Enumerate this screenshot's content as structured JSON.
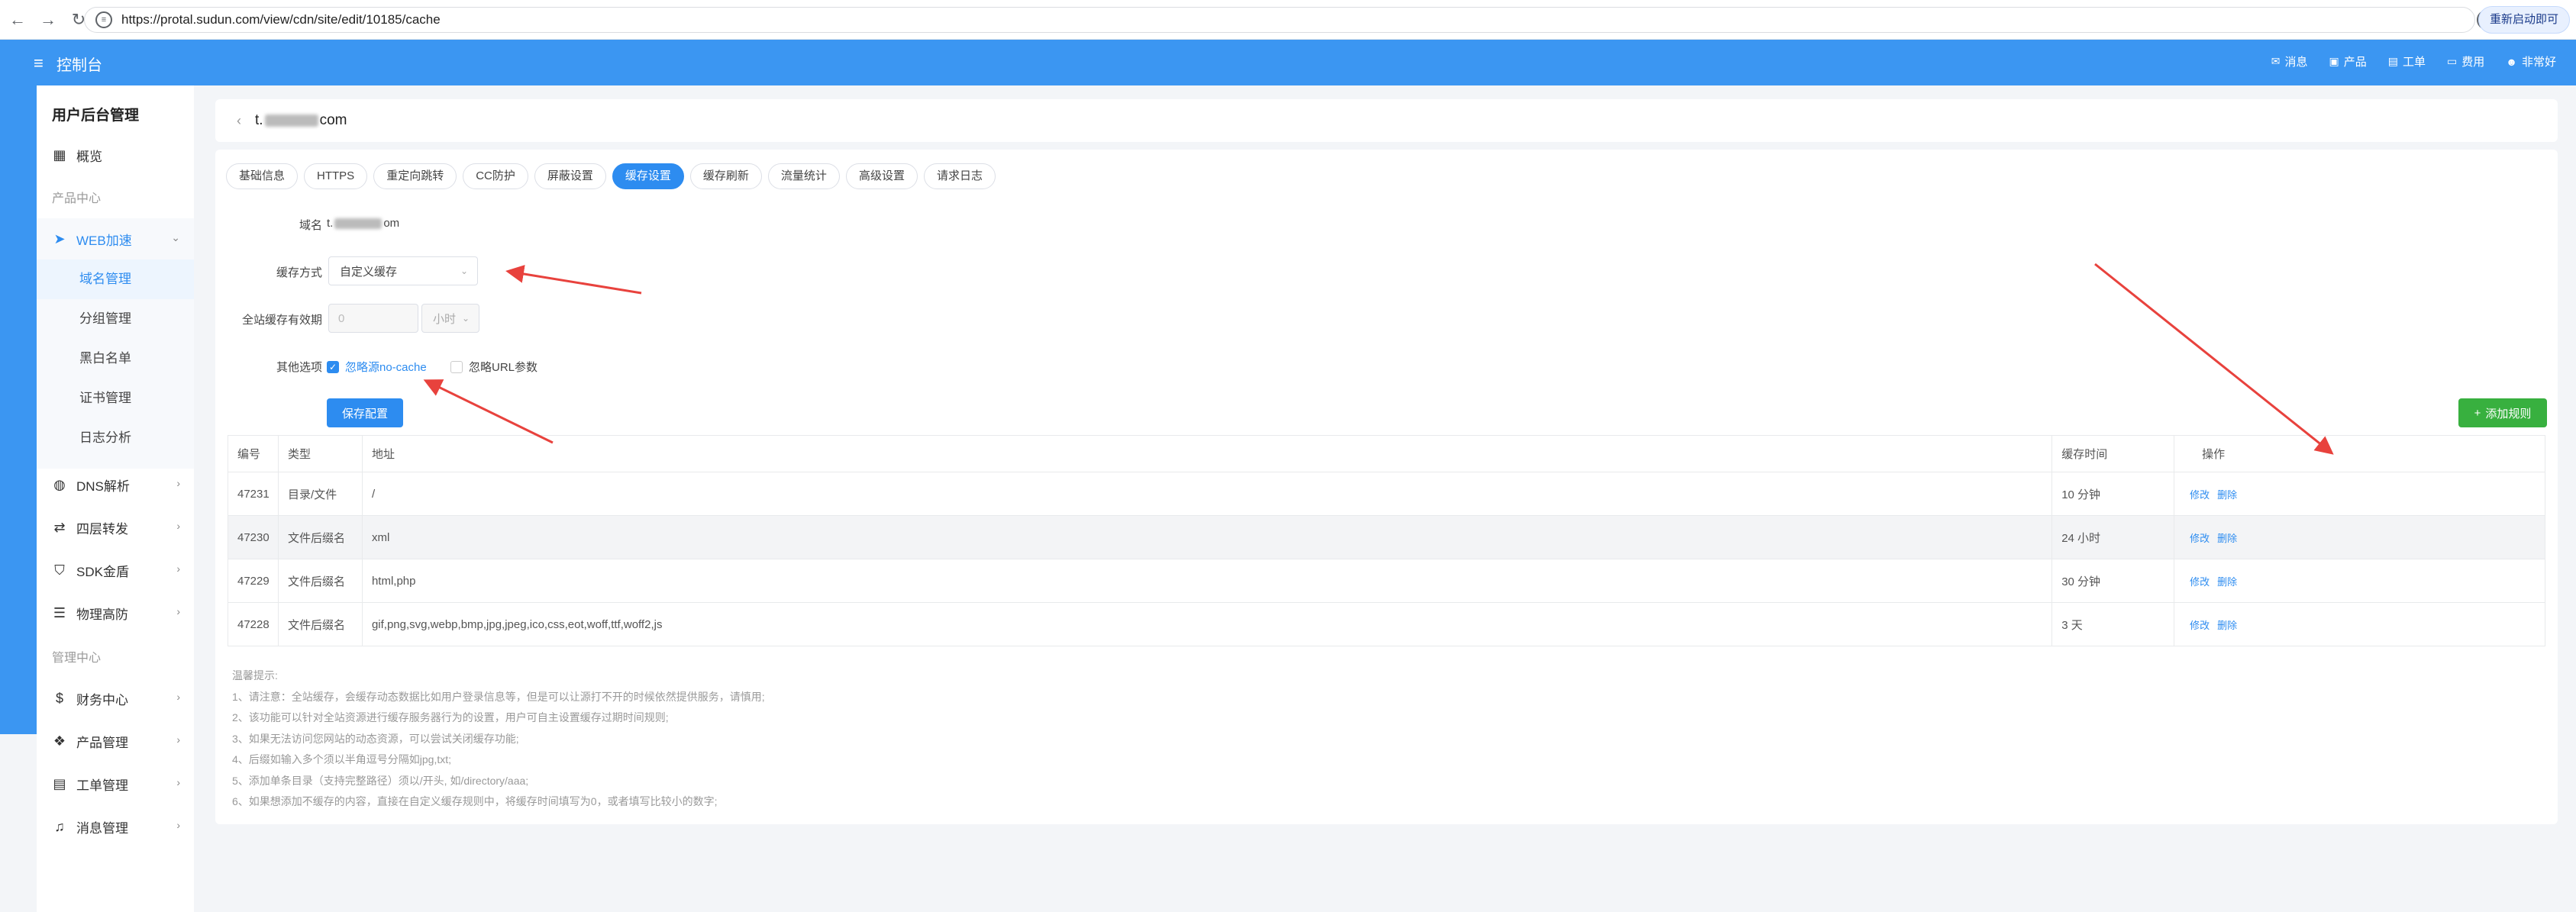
{
  "browser": {
    "url": "https://protal.sudun.com/view/cdn/site/edit/10185/cache",
    "restart_label": "重新启动即可",
    "back_icon": "arrow-left-icon",
    "forward_icon": "arrow-right-icon",
    "reload_icon": "reload-icon"
  },
  "header": {
    "title": "控制台",
    "menu": [
      {
        "label": "消息",
        "icon": "mail-icon"
      },
      {
        "label": "产品",
        "icon": "box-icon"
      },
      {
        "label": "工单",
        "icon": "ticket-icon"
      },
      {
        "label": "费用",
        "icon": "folder-icon"
      },
      {
        "label": "非常好",
        "icon": "avatar-icon"
      }
    ]
  },
  "sidebar": {
    "title": "用户后台管理",
    "overview": "概览",
    "group_product": "产品中心",
    "web": "WEB加速",
    "web_sub": [
      "域名管理",
      "分组管理",
      "黑白名单",
      "证书管理",
      "日志分析"
    ],
    "items": [
      "DNS解析",
      "四层转发",
      "SDK金盾",
      "物理高防"
    ],
    "group_manage": "管理中心",
    "manage_items": [
      "财务中心",
      "产品管理",
      "工单管理",
      "消息管理"
    ]
  },
  "page": {
    "domain_prefix": "t.",
    "domain_suffix": "com",
    "tabs": [
      "基础信息",
      "HTTPS",
      "重定向跳转",
      "CC防护",
      "屏蔽设置",
      "缓存设置",
      "缓存刷新",
      "流量统计",
      "高级设置",
      "请求日志"
    ],
    "active_tab": "缓存设置"
  },
  "form": {
    "domain_label": "域名",
    "domain_prefix": "t.",
    "domain_suffix": "om",
    "cache_mode_label": "缓存方式",
    "cache_mode_value": "自定义缓存",
    "ttl_label": "全站缓存有效期",
    "ttl_value": "0",
    "ttl_unit": "小时",
    "other_label": "其他选项",
    "opt1": "忽略源no-cache",
    "opt1_checked": true,
    "opt2": "忽略URL参数",
    "opt2_checked": false,
    "save": "保存配置",
    "add_rule": "添加规则"
  },
  "table": {
    "headers": [
      "编号",
      "类型",
      "地址",
      "缓存时间",
      "操作"
    ],
    "rows": [
      {
        "id": "47231",
        "type": "目录/文件",
        "addr": "/",
        "time": "10 分钟",
        "edit": "修改",
        "del": "删除"
      },
      {
        "id": "47230",
        "type": "文件后缀名",
        "addr": "xml",
        "time": "24 小时",
        "edit": "修改",
        "del": "删除"
      },
      {
        "id": "47229",
        "type": "文件后缀名",
        "addr": "html,php",
        "time": "30 分钟",
        "edit": "修改",
        "del": "删除"
      },
      {
        "id": "47228",
        "type": "文件后缀名",
        "addr": "gif,png,svg,webp,bmp,jpg,jpeg,ico,css,eot,woff,ttf,woff2,js",
        "time": "3 天",
        "edit": "修改",
        "del": "删除"
      }
    ]
  },
  "tips": {
    "title": "温馨提示:",
    "lines": [
      "1、请注意：全站缓存，会缓存动态数据比如用户登录信息等，但是可以让源打不开的时候依然提供服务，请慎用;",
      "2、该功能可以针对全站资源进行缓存服务器行为的设置，用户可自主设置缓存过期时间规则;",
      "3、如果无法访问您网站的动态资源，可以尝试关闭缓存功能;",
      "4、后缀如输入多个须以半角逗号分隔如jpg,txt;",
      "5、添加单条目录（支持完整路径）须以/开头, 如/directory/aaa;",
      "6、如果想添加不缓存的内容，直接在自定义缓存规则中，将缓存时间填写为0，或者填写比较小的数字;"
    ]
  },
  "colors": {
    "accent": "#3b96f2",
    "link": "#2d8cf0",
    "success": "#38b03f",
    "annotation": "#e8423d"
  }
}
